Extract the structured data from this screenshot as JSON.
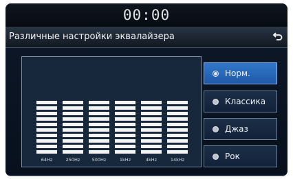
{
  "status": {
    "time": "00:00"
  },
  "header": {
    "title": "Различные настройки эквалайзера",
    "back_icon": "return-arrow-icon"
  },
  "equalizer": {
    "bands": [
      {
        "label": "64Hz",
        "level": 0
      },
      {
        "label": "250Hz",
        "level": 0
      },
      {
        "label": "500Hz",
        "level": 0
      },
      {
        "label": "1kHz",
        "level": 0
      },
      {
        "label": "4kHz",
        "level": 0
      },
      {
        "label": "14kHz",
        "level": 0
      }
    ],
    "segments_per_band": 10
  },
  "presets": [
    {
      "label": "Норм.",
      "selected": true
    },
    {
      "label": "Классика",
      "selected": false
    },
    {
      "label": "Джаз",
      "selected": false
    },
    {
      "label": "Рок",
      "selected": false
    }
  ],
  "colors": {
    "accent": "#2a6bbf",
    "background": "#0a1220",
    "panel": "#17283d"
  }
}
